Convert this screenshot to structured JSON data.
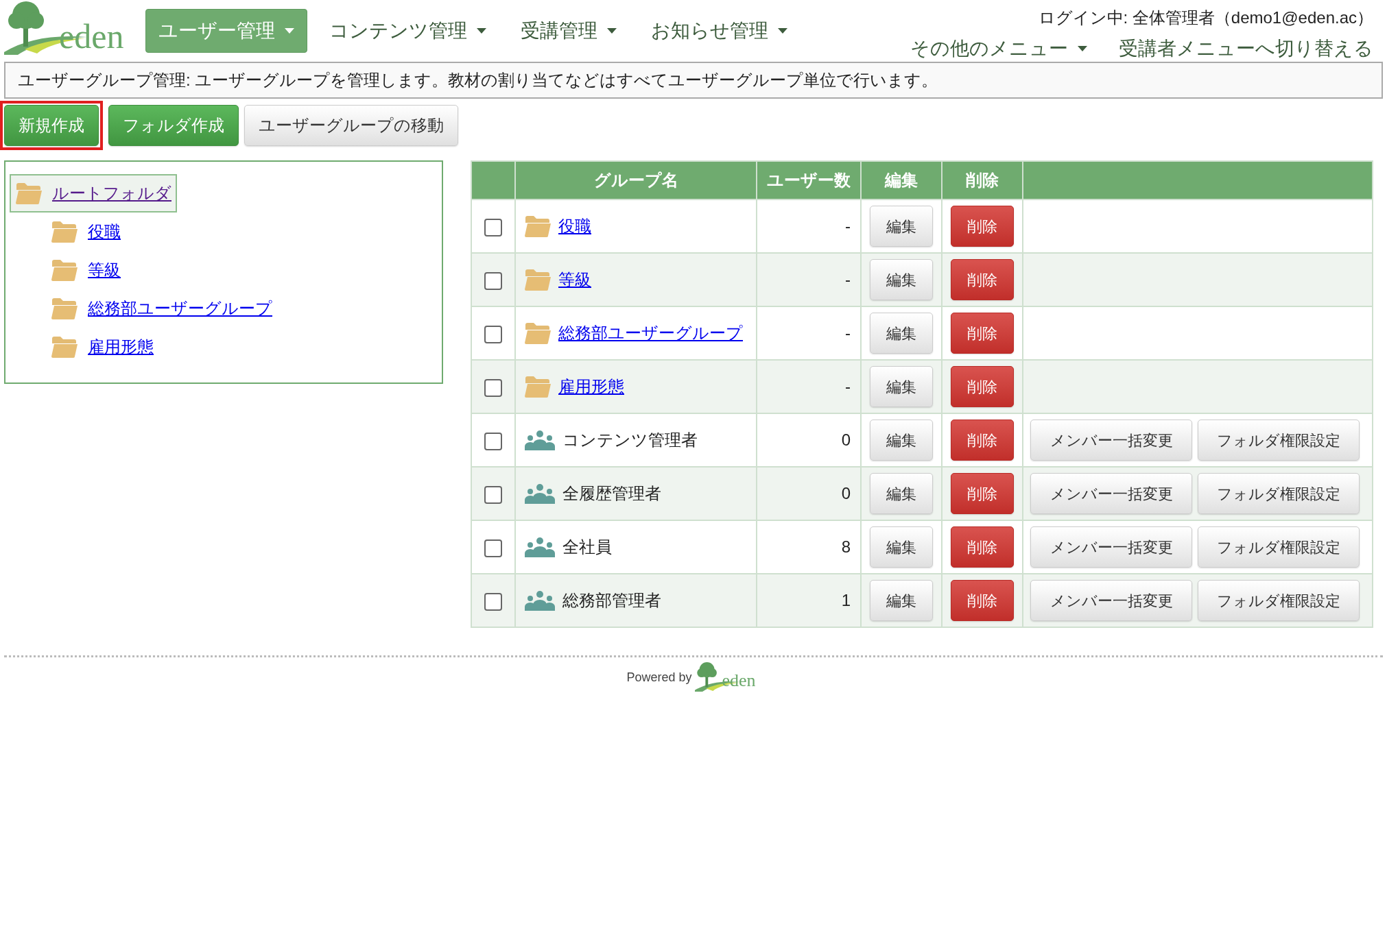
{
  "logo": {
    "text": "eden"
  },
  "nav": [
    {
      "label": "ユーザー管理",
      "selected": true
    },
    {
      "label": "コンテンツ管理",
      "selected": false
    },
    {
      "label": "受講管理",
      "selected": false
    },
    {
      "label": "お知らせ管理",
      "selected": false
    }
  ],
  "login": "ログイン中: 全体管理者（demo1@eden.ac）",
  "sub_menu": [
    {
      "label": "その他のメニュー",
      "kind": "dropdown"
    },
    {
      "label": "受講者メニューへ切り替える",
      "kind": "link"
    }
  ],
  "info": "ユーザーグループ管理: ユーザーグループを管理します。教材の割り当てなどはすべてユーザーグループ単位で行います。",
  "actions": [
    {
      "label": "新規作成",
      "kind": "primary",
      "highlighted": true
    },
    {
      "label": "フォルダ作成",
      "kind": "primary",
      "highlighted": false
    },
    {
      "label": "ユーザーグループの移動",
      "kind": "default",
      "highlighted": false
    }
  ],
  "tree": {
    "label": "ルートフォルダ",
    "selected": true,
    "children": [
      {
        "label": "役職",
        "selected": false
      },
      {
        "label": "等級",
        "selected": false
      },
      {
        "label": "総務部ユーザーグループ",
        "selected": false
      },
      {
        "label": "雇用形態",
        "selected": false
      }
    ]
  },
  "table": {
    "columns": [
      "グループ名",
      "ユーザー数",
      "編集",
      "削除"
    ],
    "rows": [
      {
        "kind": "folder",
        "checked": false,
        "name": "役職",
        "count": "-",
        "edit": "編集",
        "delete": "削除"
      },
      {
        "kind": "folder",
        "checked": false,
        "name": "等級",
        "count": "-",
        "edit": "編集",
        "delete": "削除"
      },
      {
        "kind": "folder",
        "checked": false,
        "name": "総務部ユーザーグループ",
        "count": "-",
        "edit": "編集",
        "delete": "削除"
      },
      {
        "kind": "folder",
        "checked": false,
        "name": "雇用形態",
        "count": "-",
        "edit": "編集",
        "delete": "削除"
      },
      {
        "kind": "group",
        "checked": false,
        "name": "コンテンツ管理者",
        "count": "0",
        "edit": "編集",
        "delete": "削除",
        "actions": [
          "メンバー一括変更",
          "フォルダ権限設定"
        ]
      },
      {
        "kind": "group",
        "checked": false,
        "name": "全履歴管理者",
        "count": "0",
        "edit": "編集",
        "delete": "削除",
        "actions": [
          "メンバー一括変更",
          "フォルダ権限設定"
        ]
      },
      {
        "kind": "group",
        "checked": false,
        "name": "全社員",
        "count": "8",
        "edit": "編集",
        "delete": "削除",
        "actions": [
          "メンバー一括変更",
          "フォルダ権限設定"
        ]
      },
      {
        "kind": "group",
        "checked": false,
        "name": "総務部管理者",
        "count": "1",
        "edit": "編集",
        "delete": "削除",
        "actions": [
          "メンバー一括変更",
          "フォルダ権限設定"
        ]
      }
    ]
  },
  "footer": {
    "powered_by": "Powered by",
    "logo_text": "eden"
  }
}
